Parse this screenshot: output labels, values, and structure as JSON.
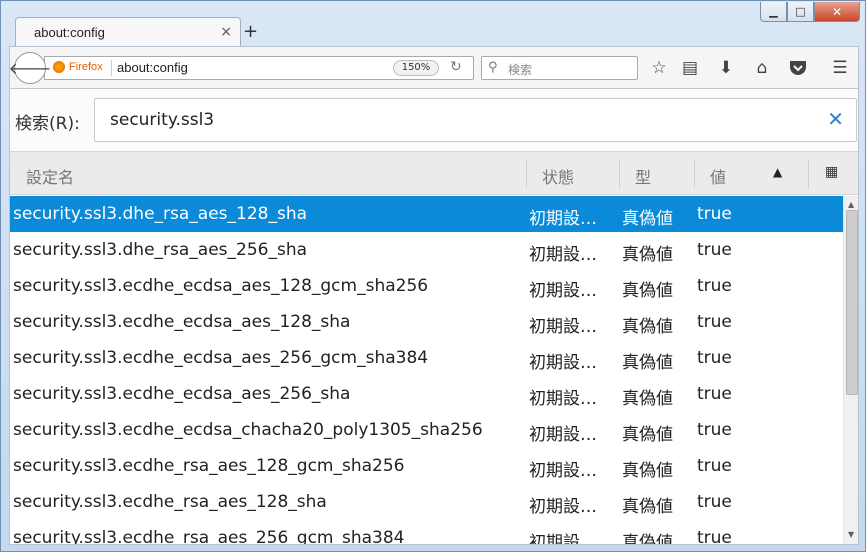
{
  "tab": {
    "title": "about:config",
    "close": "×",
    "new_tab": "+"
  },
  "window_controls": {
    "minimize": "▁",
    "maximize": "□",
    "close": "✕"
  },
  "navbar": {
    "identity_label": "Firefox",
    "url": "about:config",
    "zoom": "150%",
    "search_placeholder": "検索",
    "icons": [
      "back-icon",
      "reload-icon",
      "search-icon",
      "bookmark-star-icon",
      "reading-list-icon",
      "download-icon",
      "home-icon",
      "pocket-icon",
      "menu-icon"
    ]
  },
  "filter": {
    "label": "検索(R):",
    "value": "security.ssl3",
    "clear": "✕"
  },
  "columns": {
    "name": "設定名",
    "status": "状態",
    "type": "型",
    "value": "値"
  },
  "rows": [
    {
      "name": "security.ssl3.dhe_rsa_aes_128_sha",
      "status": "初期設定値",
      "type": "真偽値",
      "value": "true",
      "selected": true
    },
    {
      "name": "security.ssl3.dhe_rsa_aes_256_sha",
      "status": "初期設定値",
      "type": "真偽値",
      "value": "true"
    },
    {
      "name": "security.ssl3.ecdhe_ecdsa_aes_128_gcm_sha256",
      "status": "初期設定値",
      "type": "真偽値",
      "value": "true"
    },
    {
      "name": "security.ssl3.ecdhe_ecdsa_aes_128_sha",
      "status": "初期設定値",
      "type": "真偽値",
      "value": "true"
    },
    {
      "name": "security.ssl3.ecdhe_ecdsa_aes_256_gcm_sha384",
      "status": "初期設定値",
      "type": "真偽値",
      "value": "true"
    },
    {
      "name": "security.ssl3.ecdhe_ecdsa_aes_256_sha",
      "status": "初期設定値",
      "type": "真偽値",
      "value": "true"
    },
    {
      "name": "security.ssl3.ecdhe_ecdsa_chacha20_poly1305_sha256",
      "status": "初期設定値",
      "type": "真偽値",
      "value": "true"
    },
    {
      "name": "security.ssl3.ecdhe_rsa_aes_128_gcm_sha256",
      "status": "初期設定値",
      "type": "真偽値",
      "value": "true"
    },
    {
      "name": "security.ssl3.ecdhe_rsa_aes_128_sha",
      "status": "初期設定値",
      "type": "真偽値",
      "value": "true"
    },
    {
      "name": "security.ssl3.ecdhe_rsa_aes_256_gcm_sha384",
      "status": "初期設定値",
      "type": "真偽値",
      "value": "true"
    }
  ],
  "colors": {
    "selection": "#0a8ad8",
    "clear_button": "#3a7fc4",
    "identity": "#e66000"
  }
}
